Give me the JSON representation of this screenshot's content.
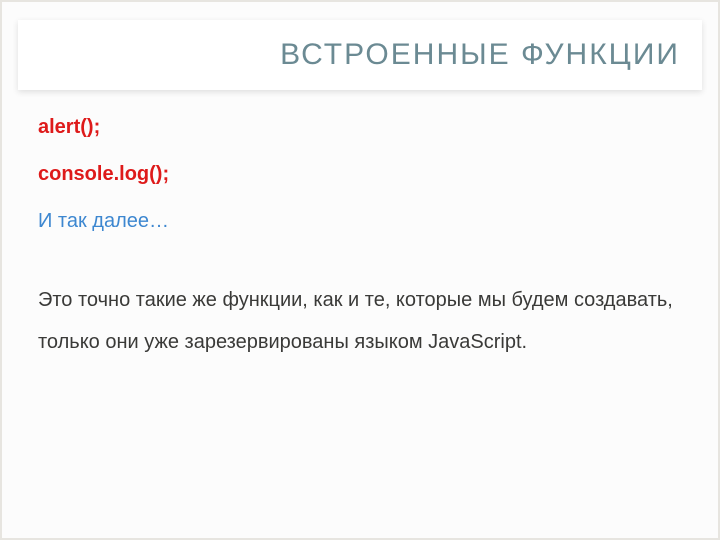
{
  "title": "ВСТРОЕННЫЕ ФУНКЦИИ",
  "functions": {
    "line1": "alert();",
    "line2": "console.log();"
  },
  "more": "И так далее…",
  "body": "Это точно такие же функции, как и те, которые мы будем создавать, только они уже зарезервированы языком JavaScript."
}
